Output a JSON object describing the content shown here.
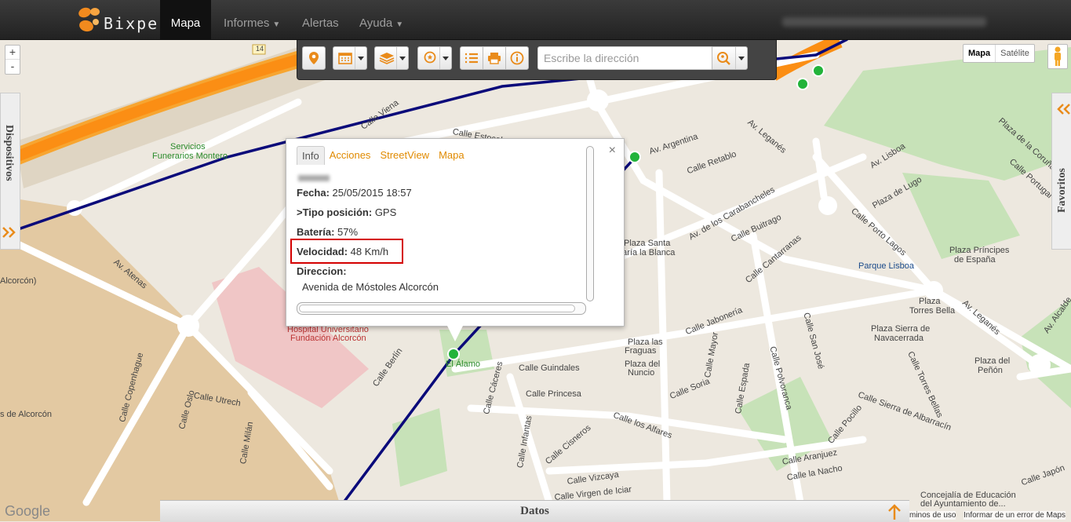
{
  "brand": {
    "name": "Bixpe"
  },
  "nav": {
    "items": [
      {
        "label": "Mapa",
        "active": true
      },
      {
        "label": "Informes",
        "dropdown": true
      },
      {
        "label": "Alertas"
      },
      {
        "label": "Ayuda",
        "dropdown": true
      }
    ]
  },
  "toolbar": {
    "address_placeholder": "Escribe la dirección"
  },
  "map": {
    "zoom_in": "+",
    "zoom_out": "-",
    "map_types": [
      "Mapa",
      "Satélite"
    ],
    "left_panel": "Dispositivos",
    "right_panel": "Favoritos",
    "labels": [
      {
        "t": "Calle Viena"
      },
      {
        "t": "Calle Estocolmo"
      },
      {
        "t": "Servicios"
      },
      {
        "t": "Funerarios Montero"
      },
      {
        "t": "Av. Argentina"
      },
      {
        "t": "Calle Retablo"
      },
      {
        "t": "Av. Leganés"
      },
      {
        "t": "Av. Lisboa"
      },
      {
        "t": "Plaza de Lugo"
      },
      {
        "t": "Calle Porto Lagos"
      },
      {
        "t": "Plaza Príncipes"
      },
      {
        "t": "de España"
      },
      {
        "t": "Parque Lisboa"
      },
      {
        "t": "Plaza"
      },
      {
        "t": "Torres Bella"
      },
      {
        "t": "Plaza Sierra de"
      },
      {
        "t": "Navacerrada"
      },
      {
        "t": "Plaza del"
      },
      {
        "t": "Peñón"
      },
      {
        "t": "Av. Atenas"
      },
      {
        "t": "Alcorcón)"
      },
      {
        "t": "Hospital Universitario"
      },
      {
        "t": "Fundación Alcorcón"
      },
      {
        "t": "Calle Berlín"
      },
      {
        "t": "El Álamo"
      },
      {
        "t": "Calle Guindales"
      },
      {
        "t": "Calle Princesa"
      },
      {
        "t": "Plaza las"
      },
      {
        "t": "Fraguas"
      },
      {
        "t": "Plaza del"
      },
      {
        "t": "Nuncio"
      },
      {
        "t": "Calle Jabonería"
      },
      {
        "t": "Calle Soria"
      },
      {
        "t": "Calle Utrech"
      },
      {
        "t": "Calle Copenhague"
      },
      {
        "t": "Calle Oslo"
      },
      {
        "t": "Calle Milán"
      },
      {
        "t": "s de Alcorcón"
      },
      {
        "t": "Calle Vizcaya"
      },
      {
        "t": "Calle Virgen de Iciar"
      },
      {
        "t": "Calle los Alfares"
      },
      {
        "t": "Calle Cisneros"
      },
      {
        "t": "Calle Aranjuez"
      },
      {
        "t": "Calle la Nacho"
      },
      {
        "t": "Calle Japón"
      },
      {
        "t": "Concejalía de Educación"
      },
      {
        "t": "del Ayuntamiento de..."
      },
      {
        "t": "Plaza Santa"
      },
      {
        "t": "María la Blanca"
      },
      {
        "t": "Av. de los Carabancheles"
      },
      {
        "t": "Calle Buitrago"
      },
      {
        "t": "Calle Cantarranas"
      },
      {
        "t": "Calle San José"
      },
      {
        "t": "Calle Polvoranca"
      },
      {
        "t": "Calle Mayor"
      },
      {
        "t": "Calle Espada"
      },
      {
        "t": "Calle Cáceres"
      },
      {
        "t": "Calle Infantas"
      },
      {
        "t": "Calle Sierra de Albarracín"
      },
      {
        "t": "Calle Pocillo"
      },
      {
        "t": "Calle Torres Bellas"
      },
      {
        "t": "Av. Leganés"
      },
      {
        "t": "Plaza de la Coruña"
      },
      {
        "t": "Calle Portugal"
      },
      {
        "t": "Av. Alcalde"
      },
      {
        "t": "14"
      }
    ]
  },
  "popup": {
    "tabs": [
      "Info",
      "Acciones",
      "StreetView",
      "Mapa"
    ],
    "close": "×",
    "rows": [
      {
        "label": "Fecha:",
        "value": "25/05/2015 18:57"
      },
      {
        "label": ">Tipo posición:",
        "value": "GPS"
      },
      {
        "label": "Batería:",
        "value": "57%"
      },
      {
        "label": "Velocidad:",
        "value": "48 Km/h"
      },
      {
        "label": "Direccion:",
        "value": ""
      }
    ],
    "address": "Avenida de Móstoles Alcorcón"
  },
  "footer": {
    "datos": "Datos",
    "google": "Google",
    "terms": "minos de uso",
    "report": "Informar de un error de Maps"
  }
}
